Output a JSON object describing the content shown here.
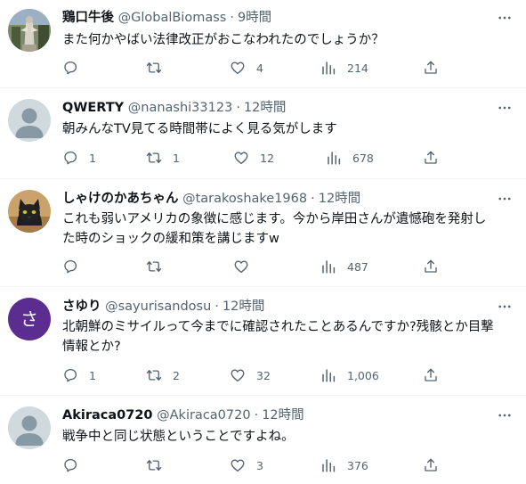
{
  "tweets": [
    {
      "name": "鶏口牛後",
      "handle": "@GlobalBiomass",
      "time": "9時間",
      "lines": [
        "また何かやばい法律改正がおこなわれたのでしょうか？"
      ],
      "avatar": "photo-statue",
      "reply": "",
      "retweet": "",
      "like": "4",
      "views": "214"
    },
    {
      "name": "QWERTY",
      "handle": "@nanashi33123",
      "time": "12時間",
      "lines": [
        "朝みんなTV見てる時間帯によく見る気がします"
      ],
      "avatar": "default",
      "reply": "1",
      "retweet": "1",
      "like": "12",
      "views": "678"
    },
    {
      "name": "しゃけのかあちゃん",
      "handle": "@tarakoshake1968",
      "time": "12時間",
      "lines": [
        "これも弱いアメリカの象徴に感じます。今から岸田さんが遺憾砲を発射し",
        "た時のショックの緩和策を講じますw"
      ],
      "avatar": "photo-cat",
      "reply": "",
      "retweet": "",
      "like": "",
      "views": "487"
    },
    {
      "name": "さゆり",
      "handle": "@sayurisandosu",
      "time": "12時間",
      "lines": [
        "北朝鮮のミサイルって今までに確認されたことあるんですか?残骸とか目撃",
        "情報とか?"
      ],
      "avatar": "letter",
      "avatar_letter": "さ",
      "reply": "1",
      "retweet": "2",
      "like": "32",
      "views": "1,006"
    },
    {
      "name": "Akiraca0720",
      "handle": "@Akiraca0720",
      "time": "12時間",
      "lines": [
        "戦争中と同じ状態ということですよね。"
      ],
      "avatar": "default",
      "reply": "",
      "retweet": "",
      "like": "3",
      "views": "376"
    }
  ],
  "header_dot": "·",
  "icons": {
    "reply": "reply-icon",
    "retweet": "retweet-icon",
    "like": "like-icon",
    "views": "views-icon",
    "share": "share-icon",
    "more": "more-icon"
  },
  "colors": {
    "text": "#0f1419",
    "secondary": "#536471",
    "separator": "#eff3f4",
    "default_avatar_bg": "#cfd9de",
    "letter_avatar_bg": "#5b2d90"
  }
}
